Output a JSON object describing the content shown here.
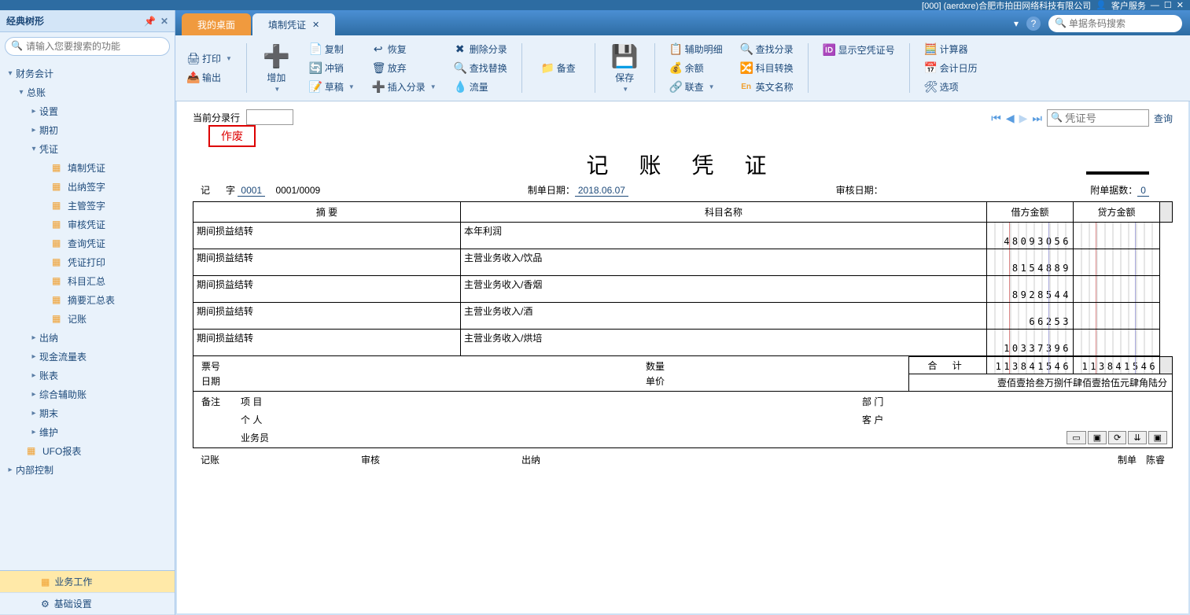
{
  "titlebar": {
    "company": "[000] (aerdxre)合肥市拍田网络科技有限公司",
    "service": "客户服务"
  },
  "sidebar": {
    "title": "经典树形",
    "search_placeholder": "请输入您要搜索的功能",
    "tree": [
      {
        "label": "财务会计",
        "level": 0,
        "arrow": "▾"
      },
      {
        "label": "总账",
        "level": 1,
        "arrow": "▾"
      },
      {
        "label": "设置",
        "level": 2,
        "arrow": "▸"
      },
      {
        "label": "期初",
        "level": 2,
        "arrow": "▸"
      },
      {
        "label": "凭证",
        "level": 2,
        "arrow": "▾"
      },
      {
        "label": "填制凭证",
        "level": 3,
        "leaf": true
      },
      {
        "label": "出纳签字",
        "level": 3,
        "leaf": true
      },
      {
        "label": "主管签字",
        "level": 3,
        "leaf": true
      },
      {
        "label": "审核凭证",
        "level": 3,
        "leaf": true
      },
      {
        "label": "查询凭证",
        "level": 3,
        "leaf": true
      },
      {
        "label": "凭证打印",
        "level": 3,
        "leaf": true
      },
      {
        "label": "科目汇总",
        "level": 3,
        "leaf": true
      },
      {
        "label": "摘要汇总表",
        "level": 3,
        "leaf": true
      },
      {
        "label": "记账",
        "level": 3,
        "leaf": true
      },
      {
        "label": "出纳",
        "level": 2,
        "arrow": "▸"
      },
      {
        "label": "现金流量表",
        "level": 2,
        "arrow": "▸"
      },
      {
        "label": "账表",
        "level": 2,
        "arrow": "▸"
      },
      {
        "label": "综合辅助账",
        "level": 2,
        "arrow": "▸"
      },
      {
        "label": "期末",
        "level": 2,
        "arrow": "▸"
      },
      {
        "label": "维护",
        "level": 2,
        "arrow": "▸"
      },
      {
        "label": "UFO报表",
        "level": 1,
        "leaf": true
      },
      {
        "label": "内部控制",
        "level": 0,
        "arrow": "▸"
      }
    ],
    "bottom": {
      "business": "业务工作",
      "basic": "基础设置"
    }
  },
  "tabs": {
    "desktop": "我的桌面",
    "current": "填制凭证",
    "help": "?",
    "global_search_placeholder": "单据条码搜索"
  },
  "ribbon": {
    "print": "打印",
    "output": "输出",
    "add": "增加",
    "copy": "复制",
    "offset": "冲销",
    "draft": "草稿",
    "restore": "恢复",
    "discard": "放弃",
    "insert": "插入分录",
    "delete": "删除分录",
    "replace": "查找替换",
    "flow": "流量",
    "backup": "备查",
    "save": "保存",
    "aux": "辅助明细",
    "balance": "余额",
    "linked": "联查",
    "find_entry": "查找分录",
    "subject_convert": "科目转换",
    "english": "英文名称",
    "show_empty": "显示空凭证号",
    "calculator": "计算器",
    "calendar": "会计日历",
    "options": "选项"
  },
  "content": {
    "current_row": "当前分录行",
    "status": "作废",
    "title": "记 账 凭 证",
    "prefix": "记",
    "word": "字",
    "no": "0001",
    "seq": "0001/0009",
    "make_date_label": "制单日期：",
    "make_date": "2018.06.07",
    "audit_date_label": "审核日期：",
    "attach_label": "附单据数：",
    "attach": "0",
    "voucher_no_placeholder": "凭证号",
    "query": "查询",
    "headers": {
      "summary": "摘  要",
      "subject": "科目名称",
      "debit": "借方金额",
      "credit": "贷方金额"
    },
    "rows": [
      {
        "summary": "期间损益结转",
        "subject": "本年利润",
        "debit": "48093056",
        "credit": ""
      },
      {
        "summary": "期间损益结转",
        "subject": "主营业务收入/饮品",
        "debit": "8154889",
        "credit": ""
      },
      {
        "summary": "期间损益结转",
        "subject": "主营业务收入/香烟",
        "debit": "8928544",
        "credit": ""
      },
      {
        "summary": "期间损益结转",
        "subject": "主营业务收入/酒",
        "debit": "66253",
        "credit": ""
      },
      {
        "summary": "期间损益结转",
        "subject": "主营业务收入/烘培",
        "debit": "10337396",
        "credit": ""
      }
    ],
    "ticket_labels": {
      "ticket": "票号",
      "date": "日期",
      "qty": "数量",
      "price": "单价"
    },
    "total_label": "合  计",
    "total_debit": "113841546",
    "total_credit": "113841546",
    "total_cn": "壹佰壹拾叁万捌仟肆佰壹拾伍元肆角陆分",
    "remark": {
      "label": "备注",
      "project": "项  目",
      "person": "个  人",
      "staff": "业务员",
      "dept": "部  门",
      "customer": "客  户"
    },
    "sign": {
      "book": "记账",
      "audit": "审核",
      "cashier": "出纳",
      "maker": "制单",
      "maker_name": "陈睿"
    }
  }
}
